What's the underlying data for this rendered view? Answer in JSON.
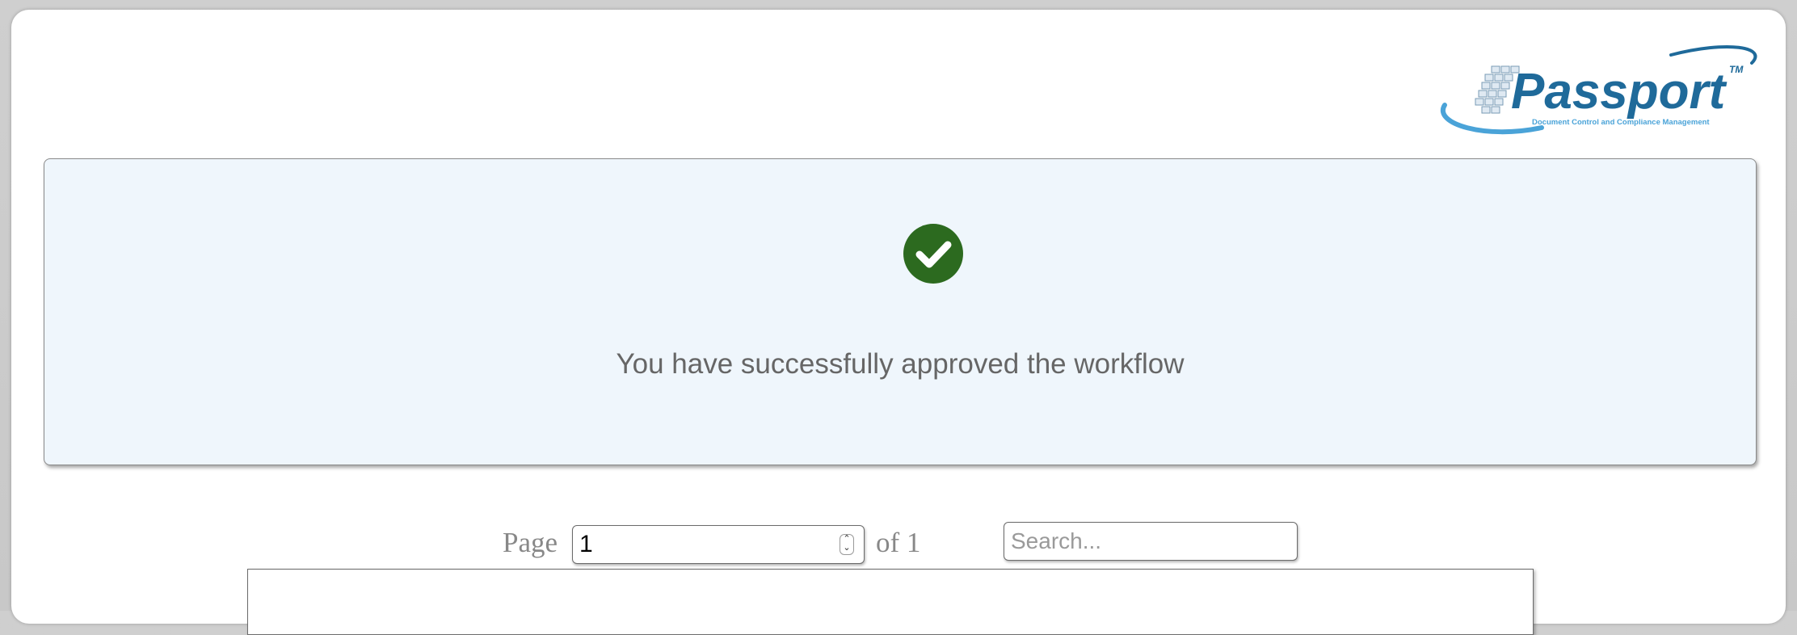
{
  "brand": {
    "name": "Passport",
    "trademark": "TM",
    "tagline": "Document Control and Compliance Management"
  },
  "status": {
    "message": "You have successfully approved the workflow",
    "icon": "check-circle-icon",
    "icon_color": "#2c6a1f"
  },
  "pager": {
    "page_label": "Page",
    "page_value": "1",
    "of_label": "of 1"
  },
  "search": {
    "placeholder": "Search..."
  },
  "colors": {
    "panel_background": "#eff6fc",
    "logo_blue": "#1f6a9a",
    "logo_light_blue": "#4aa3d8"
  }
}
